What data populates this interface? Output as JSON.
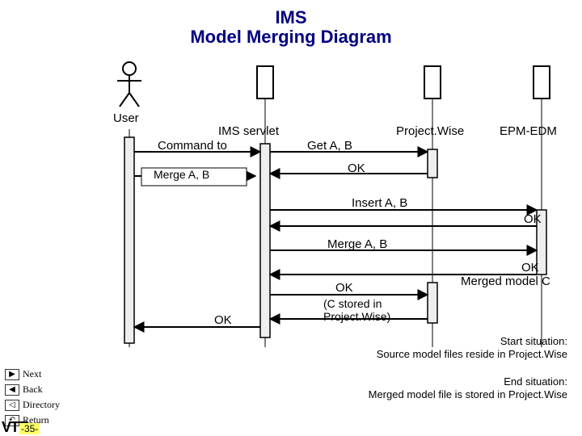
{
  "title_line1": "IMS",
  "title_line2": "Model Merging Diagram",
  "actors": {
    "user": "User",
    "ims": "IMS servlet",
    "pw": "Project.Wise",
    "epm": "EPM-EDM"
  },
  "messages": {
    "command_to": "Command to",
    "get_ab": "Get A, B",
    "merge_ab_1": "Merge A, B",
    "ok_1": "OK",
    "insert_ab": "Insert A, B",
    "ok_2": "OK",
    "merge_ab_2": "Merge A, B",
    "ok_3": "OK",
    "merged_c": "Merged model C",
    "ok_4": "OK",
    "stored": "(C stored in\nProject.Wise)",
    "ok_5": "OK"
  },
  "situation": {
    "start_label": "Start situation:",
    "start_text": "Source model files reside in Project.Wise",
    "end_label": "End situation:",
    "end_text": "Merged model file is stored in Project.Wise"
  },
  "nav": {
    "next": "Next",
    "back": "Back",
    "directory": "Directory",
    "return": "Return"
  },
  "page": "-35-",
  "logo": "VTT"
}
